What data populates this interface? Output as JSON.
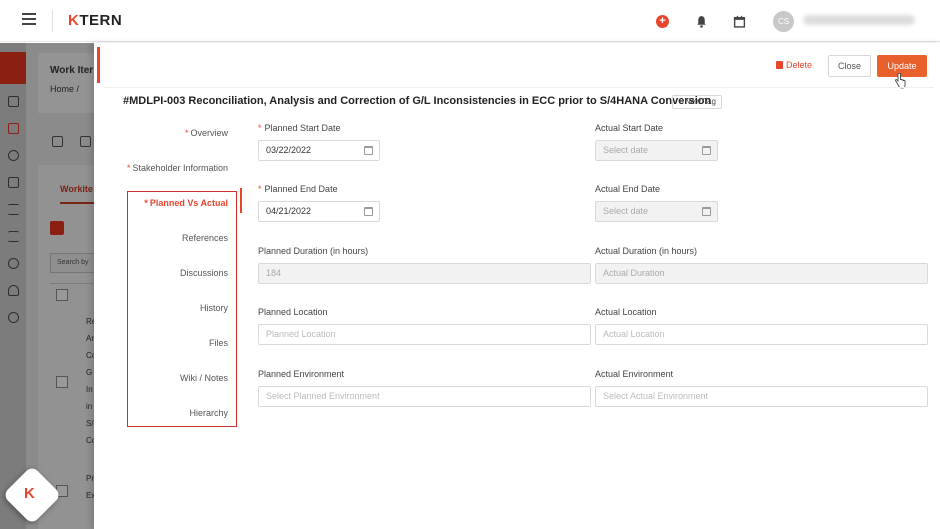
{
  "header": {
    "logo": "TERN",
    "logo_k": "K",
    "avatar_initials": "CS"
  },
  "background": {
    "title": "Work Iter",
    "breadcrumb": "Home  /",
    "tab": "Workite",
    "search": "Search by",
    "row_texts": [
      "Re",
      "Ar",
      "Co",
      "G",
      "In",
      "in",
      "S/",
      "Co",
      "Pr",
      "Ex"
    ]
  },
  "actions": {
    "delete": "Delete",
    "close": "Close",
    "update": "Update"
  },
  "work_item": {
    "title": "#MDLPI-003 Reconciliation, Analysis and Correction of G/L Inconsistencies in ECC prior to S/4HANA Conversion",
    "new_tag": "New Tag"
  },
  "nav": {
    "items": [
      {
        "label": "Overview",
        "required": "*"
      },
      {
        "label": "Stakeholder Information",
        "required": "*"
      },
      {
        "label": "Planned Vs Actual",
        "required": "*",
        "active": true
      },
      {
        "label": "References"
      },
      {
        "label": "Discussions"
      },
      {
        "label": "History"
      },
      {
        "label": "Files"
      },
      {
        "label": "Wiki / Notes"
      },
      {
        "label": "Hierarchy"
      }
    ]
  },
  "form": {
    "planned_start": {
      "label": "Planned Start Date",
      "value": "03/22/2022"
    },
    "actual_start": {
      "label": "Actual Start Date",
      "placeholder": "Select date"
    },
    "planned_end": {
      "label": "Planned End Date",
      "value": "04/21/2022"
    },
    "actual_end": {
      "label": "Actual End Date",
      "placeholder": "Select date"
    },
    "planned_duration": {
      "label": "Planned Duration   (in hours)",
      "value": "184"
    },
    "actual_duration": {
      "label": "Actual Duration  (in hours)",
      "placeholder": "Actual Duration"
    },
    "planned_location": {
      "label": "Planned Location",
      "placeholder": "Planned Location"
    },
    "actual_location": {
      "label": "Actual Location",
      "placeholder": "Actual Location"
    },
    "planned_environment": {
      "label": "Planned Environment",
      "placeholder": "Select Planned Environment"
    },
    "actual_environment": {
      "label": "Actual Environment",
      "placeholder": "Select Actual Environment"
    }
  },
  "colors": {
    "accent": "#e8452c",
    "update_button": "#e8602c",
    "highlight_box": "#d32f2f"
  }
}
